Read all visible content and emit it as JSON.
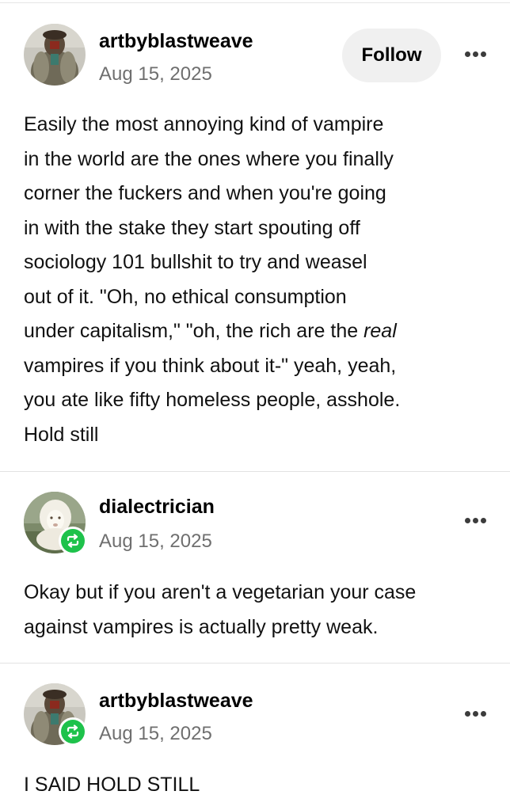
{
  "posts": [
    {
      "username": "artbyblastweave",
      "date": "Aug 15, 2025",
      "follow_label": "Follow",
      "avatar_icon": "avatar-figure-icon",
      "body_lines": [
        "Easily the most annoying kind of vampire",
        "in the world are the ones where you finally",
        "corner the fuckers and when you're going",
        "in with the stake they start spouting off",
        "sociology 101 bullshit to try and weasel",
        "out of it. \"Oh, no ethical consumption",
        "under capitalism,\" \"oh, the rich are the ",
        "vampires if you think about it-\" yeah, yeah,",
        "you ate like fifty homeless people, asshole.",
        "Hold still"
      ],
      "emphasis_word": "real"
    },
    {
      "username": "dialectrician",
      "date": "Aug 15, 2025",
      "avatar_icon": "avatar-white-lion-icon",
      "badge_icon": "reblog-icon",
      "body_lines": [
        "Okay but if you aren't a vegetarian your case",
        "against vampires is actually pretty weak."
      ]
    },
    {
      "username": "artbyblastweave",
      "date": "Aug 15, 2025",
      "avatar_icon": "avatar-figure-icon",
      "badge_icon": "reblog-icon",
      "body_lines": [
        "I SAID HOLD STILL"
      ]
    }
  ],
  "colors": {
    "reblog_badge": "#1ec24b",
    "follow_button_bg": "#f0f0f0",
    "date_text": "#6f6f6f"
  }
}
